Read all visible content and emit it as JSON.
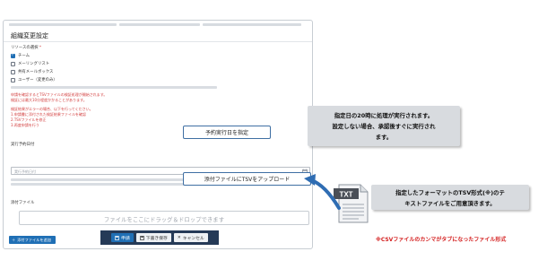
{
  "form": {
    "title": "組織変更設定",
    "resource_label": "リソースの選択",
    "resource_required_mark": "*",
    "options": [
      {
        "label": "チーム",
        "checked": true
      },
      {
        "label": "メーリングリスト",
        "checked": false
      },
      {
        "label": "共有メールボックス",
        "checked": false
      },
      {
        "label": "ユーザー（変更のみ）",
        "checked": false
      }
    ],
    "errors_a": [
      "申請を確認するとTSVファイルの検証処理が開始されます。",
      "検証には最大10分程度かかることがあります。"
    ],
    "errors_b": [
      "検証結果がエラーの場合、以下を行ってください。",
      "1.申請書に添付された検証結果ファイルを確認",
      "2.TSVファイルを修正",
      "3.再度申請を行う"
    ],
    "date_label": "実行予約日付",
    "date_placeholder": "実行予約日付",
    "attach_label": "添付ファイル",
    "drop_text": "ファイルをここにドラッグ＆ドロップできます",
    "add_file_label": "添付ファイルを追加"
  },
  "actions": {
    "submit_label": "申請",
    "draft_label": "下書き保存",
    "cancel_label": "キャンセル"
  },
  "callouts": {
    "date": "予約実行日を指定",
    "tsv": "添付ファイルにTSVをアップロード"
  },
  "notes": {
    "schedule_line1": "指定日の20時に処理が実行されます。",
    "schedule_line2": "設定しない場合、承認後すぐに実行され",
    "schedule_line3": "ます。",
    "format_line1": "指定したフォーマットのTSV形式(※)のテ",
    "format_line2": "キストファイルをご用意頂きます。",
    "csv_note": "※CSVファイルのカンマがタブになったファイル形式"
  },
  "file_icon": {
    "label": "TXT",
    "icon": "text-file-icon"
  },
  "colors": {
    "primary": "#1f6fb5",
    "action_bar": "#253a57",
    "error": "#d23c3c",
    "note_bg": "#d8dbdf",
    "callout_border": "#3f6fa3",
    "red_note": "#d42020"
  }
}
